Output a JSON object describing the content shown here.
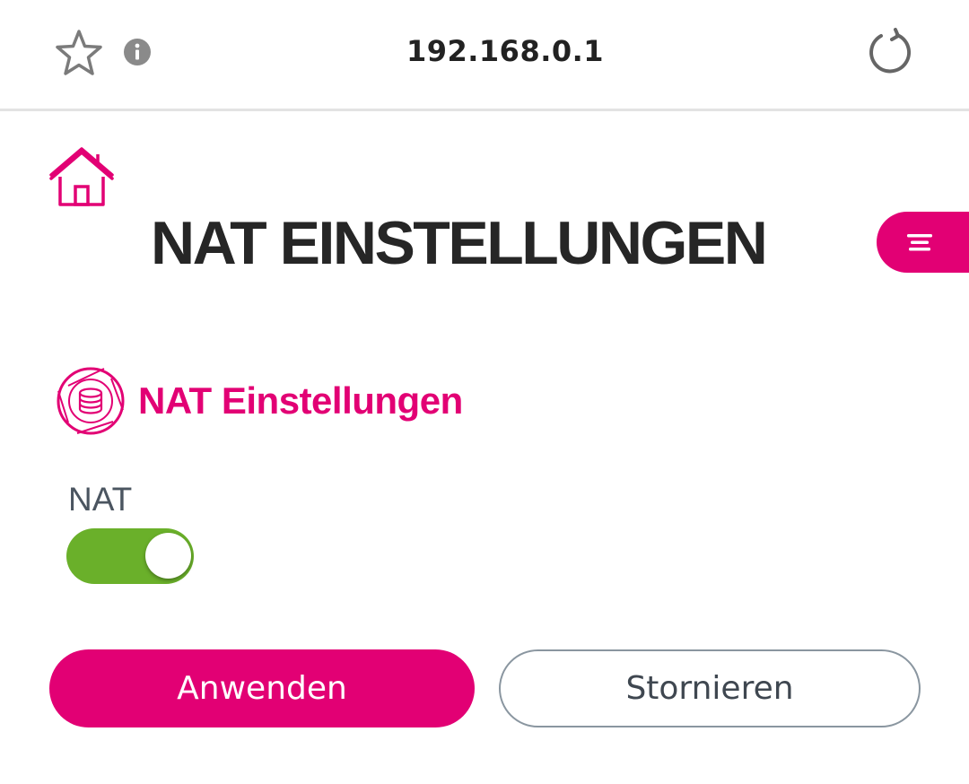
{
  "browser": {
    "url": "192.168.0.1",
    "icons": {
      "bookmark": "star-outline-icon",
      "info": "info-icon",
      "reload": "reload-icon"
    }
  },
  "header": {
    "home_icon": "home-icon",
    "title": "NAT EINSTELLUNGEN",
    "menu_icon": "menu-icon"
  },
  "section": {
    "icon": "nat-settings-icon",
    "title": "NAT Einstellungen"
  },
  "nat": {
    "label": "NAT",
    "enabled": true
  },
  "actions": {
    "apply_label": "Anwenden",
    "cancel_label": "Stornieren"
  },
  "colors": {
    "brand_magenta": "#e20074",
    "toggle_on": "#6ab02a",
    "title_text": "#262626",
    "label_text": "#4b5560"
  }
}
